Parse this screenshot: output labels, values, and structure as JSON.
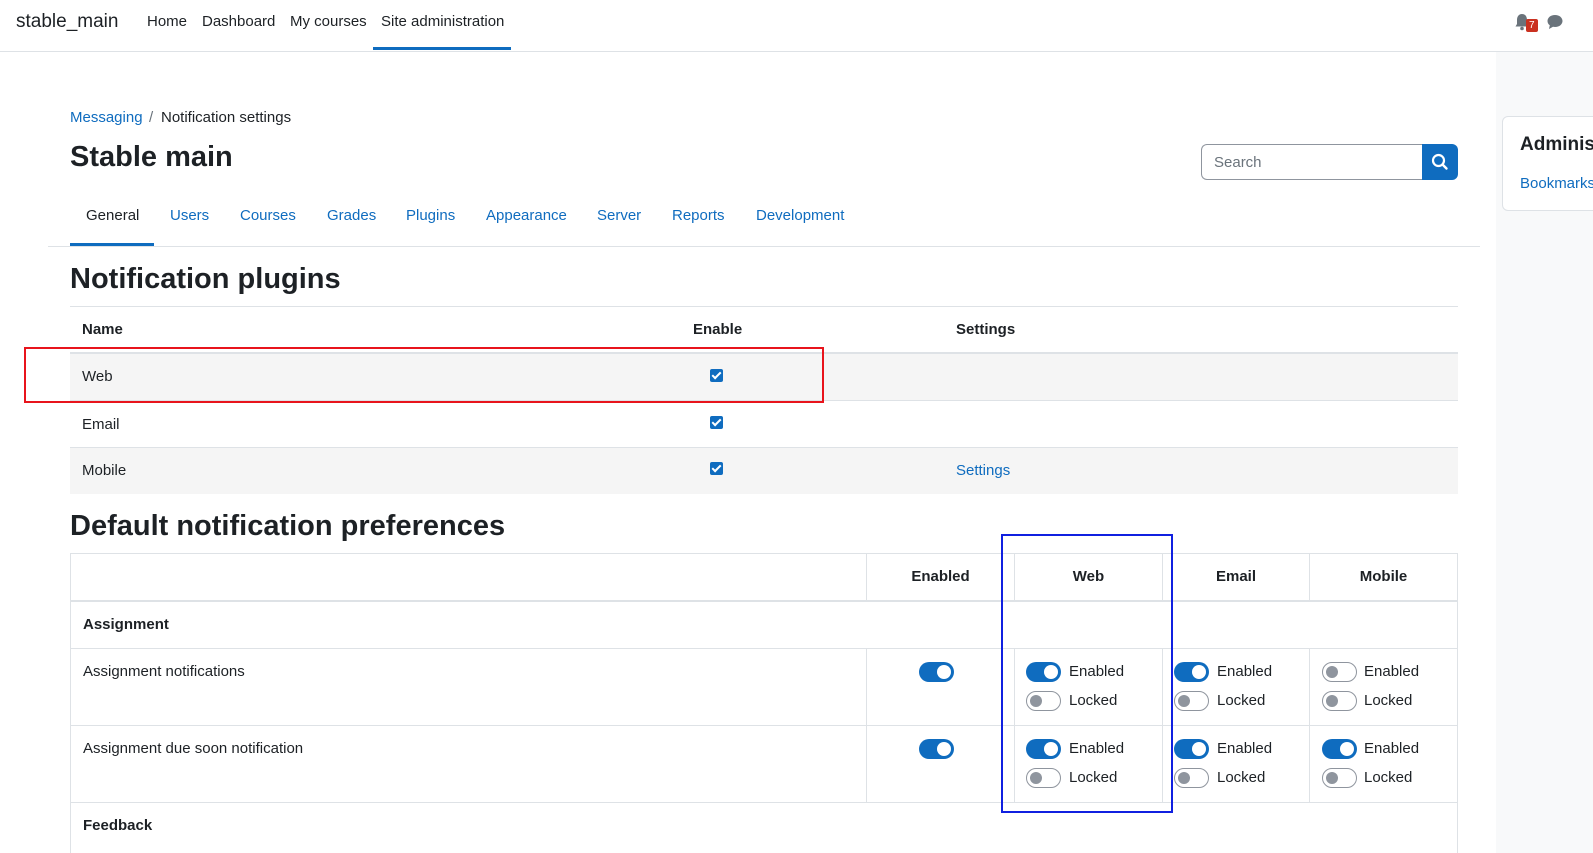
{
  "navbar": {
    "brand": "stable_main",
    "items": [
      "Home",
      "Dashboard",
      "My courses",
      "Site administration"
    ],
    "notification_count": "7"
  },
  "drawer": {
    "title": "Administration",
    "link": "Bookmarks"
  },
  "breadcrumb": {
    "parent": "Messaging",
    "separator": "/",
    "current": "Notification settings"
  },
  "page_title": "Stable main",
  "search": {
    "placeholder": "Search"
  },
  "tabs": [
    "General",
    "Users",
    "Courses",
    "Grades",
    "Plugins",
    "Appearance",
    "Server",
    "Reports",
    "Development"
  ],
  "plugins_section": {
    "title": "Notification plugins",
    "headers": [
      "Name",
      "Enable",
      "Settings"
    ],
    "rows": [
      {
        "name": "Web",
        "enabled": true,
        "settings": ""
      },
      {
        "name": "Email",
        "enabled": true,
        "settings": ""
      },
      {
        "name": "Mobile",
        "enabled": true,
        "settings": "Settings"
      }
    ]
  },
  "prefs_section": {
    "title": "Default notification preferences",
    "headers": [
      "",
      "Enabled",
      "Web",
      "Email",
      "Mobile"
    ],
    "enabled_label": "Enabled",
    "locked_label": "Locked",
    "group1": "Assignment",
    "row1": {
      "name": "Assignment notifications",
      "enabled": true,
      "web": {
        "enabled": true,
        "locked": false
      },
      "email": {
        "enabled": true,
        "locked": false
      },
      "mobile": {
        "enabled": false,
        "locked": false
      }
    },
    "row2": {
      "name": "Assignment due soon notification",
      "enabled": true,
      "web": {
        "enabled": true,
        "locked": false
      },
      "email": {
        "enabled": true,
        "locked": false
      },
      "mobile": {
        "enabled": true,
        "locked": false
      }
    },
    "group2": "Feedback"
  }
}
